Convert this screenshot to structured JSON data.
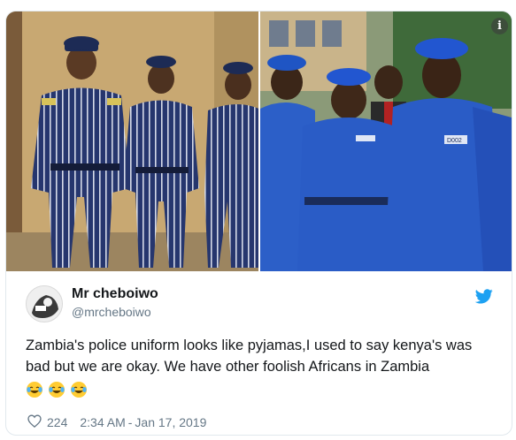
{
  "tweet": {
    "author_name": "Mr cheboiwo",
    "author_handle": "@mrcheboiwo",
    "text": "Zambia's police uniform looks like pyjamas,I used to say kenya's was bad but we are okay. We have other foolish Africans in Zambia",
    "emojis": [
      "face-with-tears-of-joy",
      "face-with-tears-of-joy",
      "face-with-tears-of-joy"
    ],
    "like_count": "224",
    "time": "2:34 AM",
    "date_separator": "-",
    "date": "Jan 17, 2019"
  },
  "media": {
    "left_photo": "three officers in navy pinstriped uniforms with peaked caps",
    "right_photo": "police officers in blue uniforms and berets",
    "info_icon": "i",
    "badge_text": "D002"
  },
  "icons": {
    "brand": "twitter-bird-icon",
    "like": "heart-outline-icon",
    "info": "info-icon"
  },
  "colors": {
    "twitter_blue": "#1da1f2",
    "secondary_text": "#657786",
    "border": "#e1e8ed",
    "uniform_navy": "#2b3f7a",
    "uniform_blue": "#2a5cc6"
  }
}
